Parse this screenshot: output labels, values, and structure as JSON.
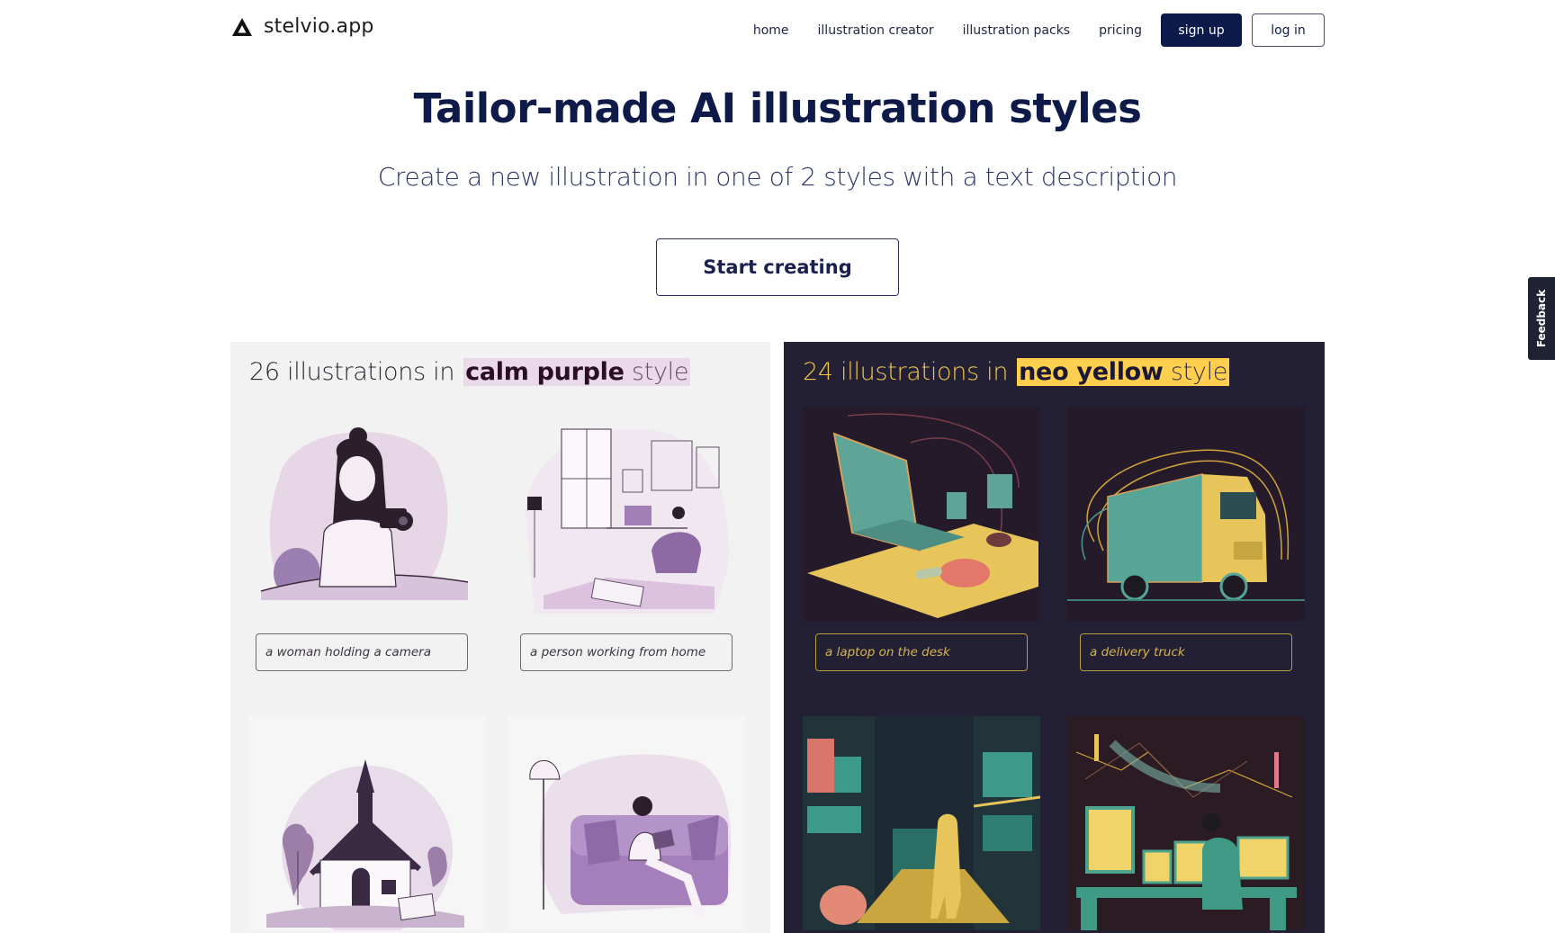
{
  "header": {
    "logo": {
      "icon": "triangle-logo-icon",
      "text": "stelvio.app"
    },
    "nav": [
      {
        "label": "home"
      },
      {
        "label": "illustration creator"
      },
      {
        "label": "illustration packs"
      },
      {
        "label": "pricing"
      }
    ],
    "signup_label": "sign up",
    "login_label": "log in"
  },
  "hero": {
    "title": "Tailor-made AI illustration styles",
    "subtitle": "Create a new illustration in one of 2 styles with a text description",
    "cta_label": "Start creating"
  },
  "feedback_label": "Feedback",
  "panels": [
    {
      "count_text": "26 illustrations in",
      "style_name": "calm purple",
      "style_word": "style",
      "colors": {
        "background": "#f2f2f2",
        "highlight": "#ead9e8",
        "text": "#2a2730"
      },
      "items": [
        {
          "caption": "a woman holding a camera",
          "illustration": "woman-with-camera-illustration"
        },
        {
          "caption": "a person working from home",
          "illustration": "home-office-illustration"
        },
        {
          "caption": "",
          "illustration": "chapel-illustration"
        },
        {
          "caption": "",
          "illustration": "woman-reading-on-sofa-illustration"
        }
      ]
    },
    {
      "count_text": "24 illustrations in",
      "style_name": "neo yellow",
      "style_word": "style",
      "colors": {
        "background": "#232036",
        "highlight": "#ffcf4d",
        "text": "#f0c64c"
      },
      "items": [
        {
          "caption": "a laptop on the desk",
          "illustration": "laptop-on-desk-illustration"
        },
        {
          "caption": "a delivery truck",
          "illustration": "delivery-truck-illustration"
        },
        {
          "caption": "",
          "illustration": "man-in-warehouse-illustration"
        },
        {
          "caption": "",
          "illustration": "trader-at-monitors-illustration"
        }
      ]
    }
  ]
}
